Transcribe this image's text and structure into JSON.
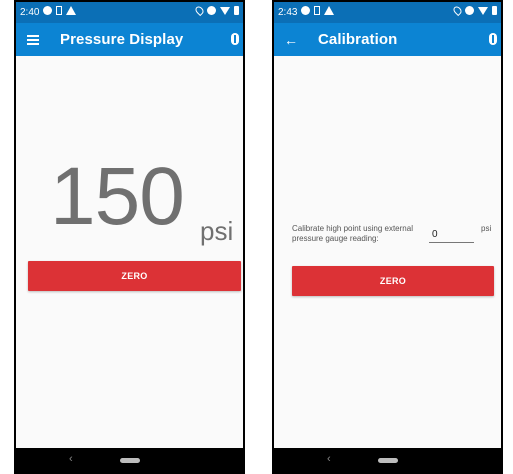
{
  "screens": [
    {
      "status_bar": {
        "time": "2:40",
        "icons": [
          "status-app-icon",
          "sim-icon",
          "warning-icon",
          "location-icon",
          "wifi-icon",
          "battery-icon"
        ]
      },
      "app_bar": {
        "title": "Pressure Display",
        "nav_icon": "menu-icon",
        "action_icon": "bluetooth-icon"
      },
      "reading": {
        "value": "150",
        "unit": "psi"
      },
      "zero_button": "ZERO"
    },
    {
      "status_bar": {
        "time": "2:43",
        "icons": [
          "status-app-icon",
          "sim-icon",
          "warning-icon",
          "location-icon",
          "wifi-icon",
          "battery-icon"
        ]
      },
      "app_bar": {
        "title": "Calibration",
        "nav_icon": "back-arrow-icon",
        "action_icon": "bluetooth-icon"
      },
      "calibration": {
        "label": "Calibrate high point using external pressure gauge reading:",
        "input_value": "0",
        "unit": "psi"
      },
      "zero_button": "ZERO"
    }
  ],
  "nav_bar": {
    "back_glyph": "‹"
  },
  "colors": {
    "status_bar": "#0b6fb6",
    "app_bar": "#0c84d3",
    "zero_button": "#dc3236",
    "reading_text": "#707070"
  }
}
